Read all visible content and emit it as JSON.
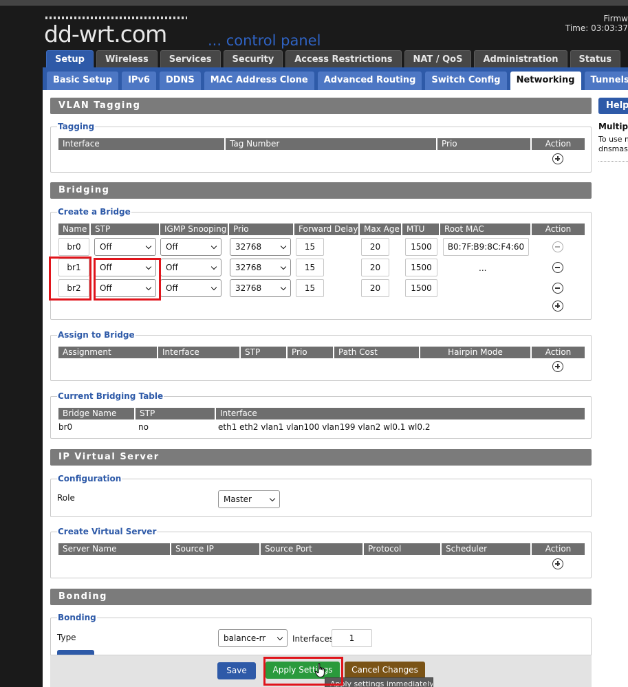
{
  "header": {
    "logo_text": "dd-wrt.com",
    "logo_subtitle": "... control panel",
    "firmware_label": "Firmw",
    "time_text": "Time: 03:03:37"
  },
  "main_tabs": [
    {
      "label": "Setup",
      "active": true
    },
    {
      "label": "Wireless",
      "active": false
    },
    {
      "label": "Services",
      "active": false
    },
    {
      "label": "Security",
      "active": false
    },
    {
      "label": "Access Restrictions",
      "active": false
    },
    {
      "label": "NAT / QoS",
      "active": false
    },
    {
      "label": "Administration",
      "active": false
    },
    {
      "label": "Status",
      "active": false
    }
  ],
  "sub_tabs": [
    {
      "label": "Basic Setup",
      "active": false
    },
    {
      "label": "IPv6",
      "active": false
    },
    {
      "label": "DDNS",
      "active": false
    },
    {
      "label": "MAC Address Clone",
      "active": false
    },
    {
      "label": "Advanced Routing",
      "active": false
    },
    {
      "label": "Switch Config",
      "active": false
    },
    {
      "label": "Networking",
      "active": true
    },
    {
      "label": "Tunnels",
      "active": false
    }
  ],
  "vlan": {
    "section_title": "VLAN Tagging",
    "legend": "Tagging",
    "columns": [
      "Interface",
      "Tag Number",
      "Prio",
      "Action"
    ]
  },
  "bridging": {
    "section_title": "Bridging",
    "create_legend": "Create a Bridge",
    "columns": [
      "Name",
      "STP",
      "IGMP Snooping",
      "Prio",
      "Forward Delay",
      "Max Age",
      "MTU",
      "Root MAC",
      "Action"
    ],
    "rows": [
      {
        "name": "br0",
        "stp": "Off",
        "igmp": "Off",
        "prio": "32768",
        "forward_delay": "15",
        "max_age": "20",
        "mtu": "1500",
        "root_mac": "B0:7F:B9:8C:F4:60"
      },
      {
        "name": "br1",
        "stp": "Off",
        "igmp": "Off",
        "prio": "32768",
        "forward_delay": "15",
        "max_age": "20",
        "mtu": "1500",
        "root_mac": "..."
      },
      {
        "name": "br2",
        "stp": "Off",
        "igmp": "Off",
        "prio": "32768",
        "forward_delay": "15",
        "max_age": "20",
        "mtu": "1500",
        "root_mac": ""
      }
    ],
    "assign_legend": "Assign to Bridge",
    "assign_columns": [
      "Assignment",
      "Interface",
      "STP",
      "Prio",
      "Path Cost",
      "Hairpin Mode",
      "Action"
    ],
    "table_legend": "Current Bridging Table",
    "table_columns": [
      "Bridge Name",
      "STP",
      "Interface"
    ],
    "table_row": {
      "bridge_name": "br0",
      "stp": "no",
      "interface": "eth1 eth2 vlan1 vlan100 vlan199 vlan2 wl0.1 wl0.2"
    }
  },
  "ipvs": {
    "section_title": "IP Virtual Server",
    "config_legend": "Configuration",
    "role_label": "Role",
    "role_value": "Master",
    "create_legend": "Create Virtual Server",
    "columns": [
      "Server Name",
      "Source IP",
      "Source Port",
      "Protocol",
      "Scheduler",
      "Action"
    ]
  },
  "bonding": {
    "section_title": "Bonding",
    "legend": "Bonding",
    "type_label": "Type",
    "type_value": "balance-rr",
    "interfaces_label": "Interfaces",
    "interfaces_value": "1"
  },
  "help": {
    "title": "Help",
    "heading": "Multiple",
    "line1": "To use m",
    "line2": "dnsmasq"
  },
  "footer": {
    "save_label": "Save",
    "apply_label": "Apply Settings",
    "cancel_label": "Cancel Changes",
    "tooltip": "Apply settings immediately"
  },
  "colors": {
    "accent_blue": "#2e5aa8",
    "save_blue": "#2e5aa8",
    "apply_green": "#2a9a3c",
    "cancel_brown": "#7a5316",
    "highlight_red": "#e0141b"
  }
}
